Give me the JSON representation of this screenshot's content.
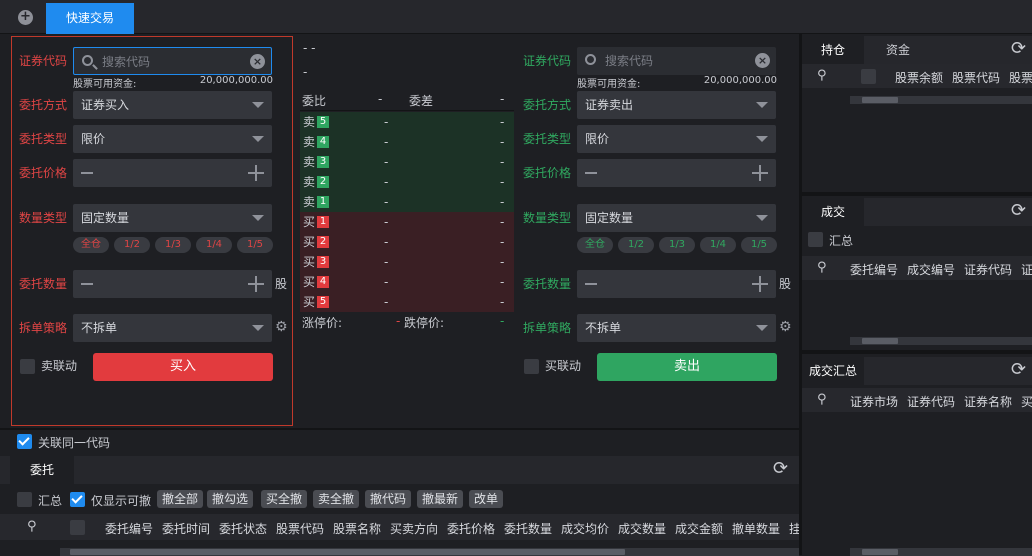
{
  "top": {
    "active_tab": "快速交易"
  },
  "buy": {
    "code_label": "证券代码",
    "search_placeholder": "搜索代码",
    "funds_label": "股票可用资金:",
    "funds_value": "20,000,000.00",
    "order_way_label": "委托方式",
    "order_way": "证券买入",
    "order_type_label": "委托类型",
    "order_type": "限价",
    "price_label": "委托价格",
    "qty_type_label": "数量类型",
    "qty_type": "固定数量",
    "chips": [
      "全仓",
      "1/2",
      "1/3",
      "1/4",
      "1/5"
    ],
    "qty_label": "委托数量",
    "unit": "股",
    "split_label": "拆单策略",
    "split": "不拆单",
    "link_label": "卖联动",
    "submit": "买入"
  },
  "sell": {
    "code_label": "证券代码",
    "search_placeholder": "搜索代码",
    "funds_label": "股票可用资金:",
    "funds_value": "20,000,000.00",
    "order_way_label": "委托方式",
    "order_way": "证券卖出",
    "order_type_label": "委托类型",
    "order_type": "限价",
    "price_label": "委托价格",
    "qty_type_label": "数量类型",
    "qty_type": "固定数量",
    "chips": [
      "全仓",
      "1/2",
      "1/3",
      "1/4",
      "1/5"
    ],
    "qty_label": "委托数量",
    "unit": "股",
    "split_label": "拆单策略",
    "split": "不拆单",
    "link_label": "买联动",
    "submit": "卖出"
  },
  "orderbook": {
    "line1": "- -",
    "line2": "-",
    "ratio_label": "委比",
    "ratio_value": "-",
    "diff_label": "委差",
    "diff_value": "-",
    "sell_rows": [
      {
        "side": "卖",
        "level": "5",
        "price": "-",
        "vol": "-"
      },
      {
        "side": "卖",
        "level": "4",
        "price": "-",
        "vol": "-"
      },
      {
        "side": "卖",
        "level": "3",
        "price": "-",
        "vol": "-"
      },
      {
        "side": "卖",
        "level": "2",
        "price": "-",
        "vol": "-"
      },
      {
        "side": "卖",
        "level": "1",
        "price": "-",
        "vol": "-"
      }
    ],
    "buy_rows": [
      {
        "side": "买",
        "level": "1",
        "price": "-",
        "vol": "-"
      },
      {
        "side": "买",
        "level": "2",
        "price": "-",
        "vol": "-"
      },
      {
        "side": "买",
        "level": "3",
        "price": "-",
        "vol": "-"
      },
      {
        "side": "买",
        "level": "4",
        "price": "-",
        "vol": "-"
      },
      {
        "side": "买",
        "level": "5",
        "price": "-",
        "vol": "-"
      }
    ],
    "limit_up_label": "涨停价:",
    "limit_up": "-",
    "limit_down_label": "跌停价:",
    "limit_down": "-"
  },
  "right": {
    "positions": {
      "tabs": [
        "持仓",
        "资金"
      ],
      "columns": [
        "股票余额",
        "股票代码",
        "股票"
      ]
    },
    "trades": {
      "tab": "成交",
      "summary_label": "汇总",
      "columns": [
        "委托编号",
        "成交编号",
        "证券代码",
        "证"
      ]
    },
    "trade_summary": {
      "tab": "成交汇总",
      "columns": [
        "证券市场",
        "证券代码",
        "证券名称",
        "买"
      ]
    }
  },
  "bottom": {
    "link_same_code": "关联同一代码",
    "tab": "委托",
    "summary_label": "汇总",
    "only_cancelable": "仅显示可撤",
    "actions": [
      "撤全部",
      "撤勾选",
      "买全撤",
      "卖全撤",
      "撤代码",
      "撤最新",
      "改单"
    ],
    "columns": [
      "委托编号",
      "委托时间",
      "委托状态",
      "股票代码",
      "股票名称",
      "买卖方向",
      "委托价格",
      "委托数量",
      "成交均价",
      "成交数量",
      "成交金额",
      "撤单数量",
      "挂"
    ]
  }
}
